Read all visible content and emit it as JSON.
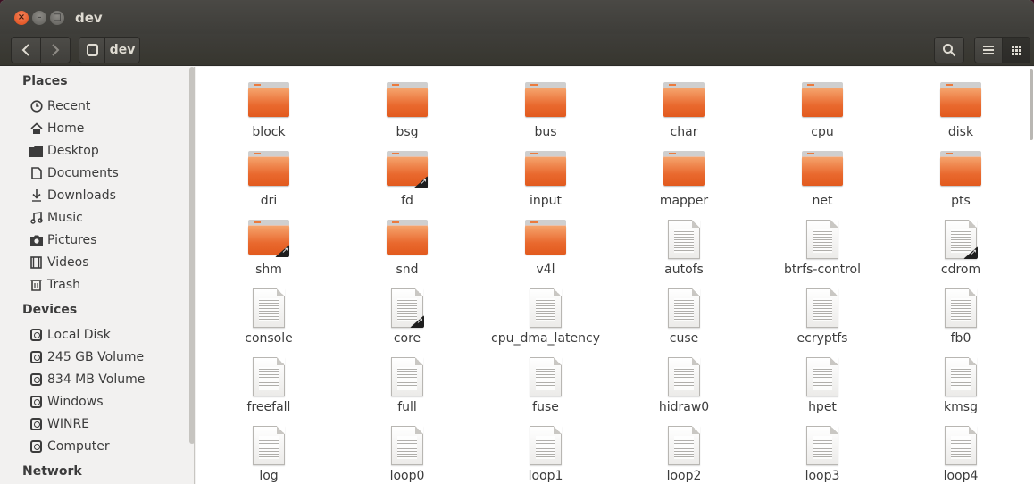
{
  "window": {
    "title": "dev",
    "controls": {
      "close": "×",
      "minimize": "–",
      "maximize": "□"
    }
  },
  "toolbar": {
    "back": "‹",
    "forward": "›",
    "path_label": "dev",
    "icons": [
      "search-icon",
      "list-view-icon",
      "grid-view-icon"
    ]
  },
  "sidebar": {
    "places_header": "Places",
    "places": [
      {
        "label": "Recent",
        "icon": "recent-icon"
      },
      {
        "label": "Home",
        "icon": "home-icon"
      },
      {
        "label": "Desktop",
        "icon": "desktop-icon"
      },
      {
        "label": "Documents",
        "icon": "documents-icon"
      },
      {
        "label": "Downloads",
        "icon": "downloads-icon"
      },
      {
        "label": "Music",
        "icon": "music-icon"
      },
      {
        "label": "Pictures",
        "icon": "pictures-icon"
      },
      {
        "label": "Videos",
        "icon": "videos-icon"
      },
      {
        "label": "Trash",
        "icon": "trash-icon"
      }
    ],
    "devices_header": "Devices",
    "devices": [
      {
        "label": "Local Disk"
      },
      {
        "label": "245 GB Volume"
      },
      {
        "label": "834 MB Volume"
      },
      {
        "label": "Windows"
      },
      {
        "label": "WINRE"
      },
      {
        "label": "Computer"
      }
    ],
    "network_header": "Network"
  },
  "files": [
    {
      "name": "block",
      "type": "folder",
      "link": false
    },
    {
      "name": "bsg",
      "type": "folder",
      "link": false
    },
    {
      "name": "bus",
      "type": "folder",
      "link": false
    },
    {
      "name": "char",
      "type": "folder",
      "link": false
    },
    {
      "name": "cpu",
      "type": "folder",
      "link": false
    },
    {
      "name": "disk",
      "type": "folder",
      "link": false
    },
    {
      "name": "dri",
      "type": "folder",
      "link": false
    },
    {
      "name": "fd",
      "type": "folder",
      "link": true
    },
    {
      "name": "input",
      "type": "folder",
      "link": false
    },
    {
      "name": "mapper",
      "type": "folder",
      "link": false
    },
    {
      "name": "net",
      "type": "folder",
      "link": false
    },
    {
      "name": "pts",
      "type": "folder",
      "link": false
    },
    {
      "name": "shm",
      "type": "folder",
      "link": true
    },
    {
      "name": "snd",
      "type": "folder",
      "link": false
    },
    {
      "name": "v4l",
      "type": "folder",
      "link": false
    },
    {
      "name": "autofs",
      "type": "file",
      "link": false
    },
    {
      "name": "btrfs-control",
      "type": "file",
      "link": false
    },
    {
      "name": "cdrom",
      "type": "file",
      "link": true
    },
    {
      "name": "console",
      "type": "file",
      "link": false
    },
    {
      "name": "core",
      "type": "file",
      "link": true
    },
    {
      "name": "cpu_dma_latency",
      "type": "file",
      "link": false
    },
    {
      "name": "cuse",
      "type": "file",
      "link": false
    },
    {
      "name": "ecryptfs",
      "type": "file",
      "link": false
    },
    {
      "name": "fb0",
      "type": "file",
      "link": false
    },
    {
      "name": "freefall",
      "type": "file",
      "link": false
    },
    {
      "name": "full",
      "type": "file",
      "link": false
    },
    {
      "name": "fuse",
      "type": "file",
      "link": false
    },
    {
      "name": "hidraw0",
      "type": "file",
      "link": false
    },
    {
      "name": "hpet",
      "type": "file",
      "link": false
    },
    {
      "name": "kmsg",
      "type": "file",
      "link": false
    },
    {
      "name": "log",
      "type": "file",
      "link": false
    },
    {
      "name": "loop0",
      "type": "file",
      "link": false
    },
    {
      "name": "loop1",
      "type": "file",
      "link": false
    },
    {
      "name": "loop2",
      "type": "file",
      "link": false
    },
    {
      "name": "loop3",
      "type": "file",
      "link": false
    },
    {
      "name": "loop4",
      "type": "file",
      "link": false
    }
  ],
  "colors": {
    "titlebar": "#3d3c38",
    "folder_orange": "#e9692e",
    "close_button": "#df4a15"
  }
}
